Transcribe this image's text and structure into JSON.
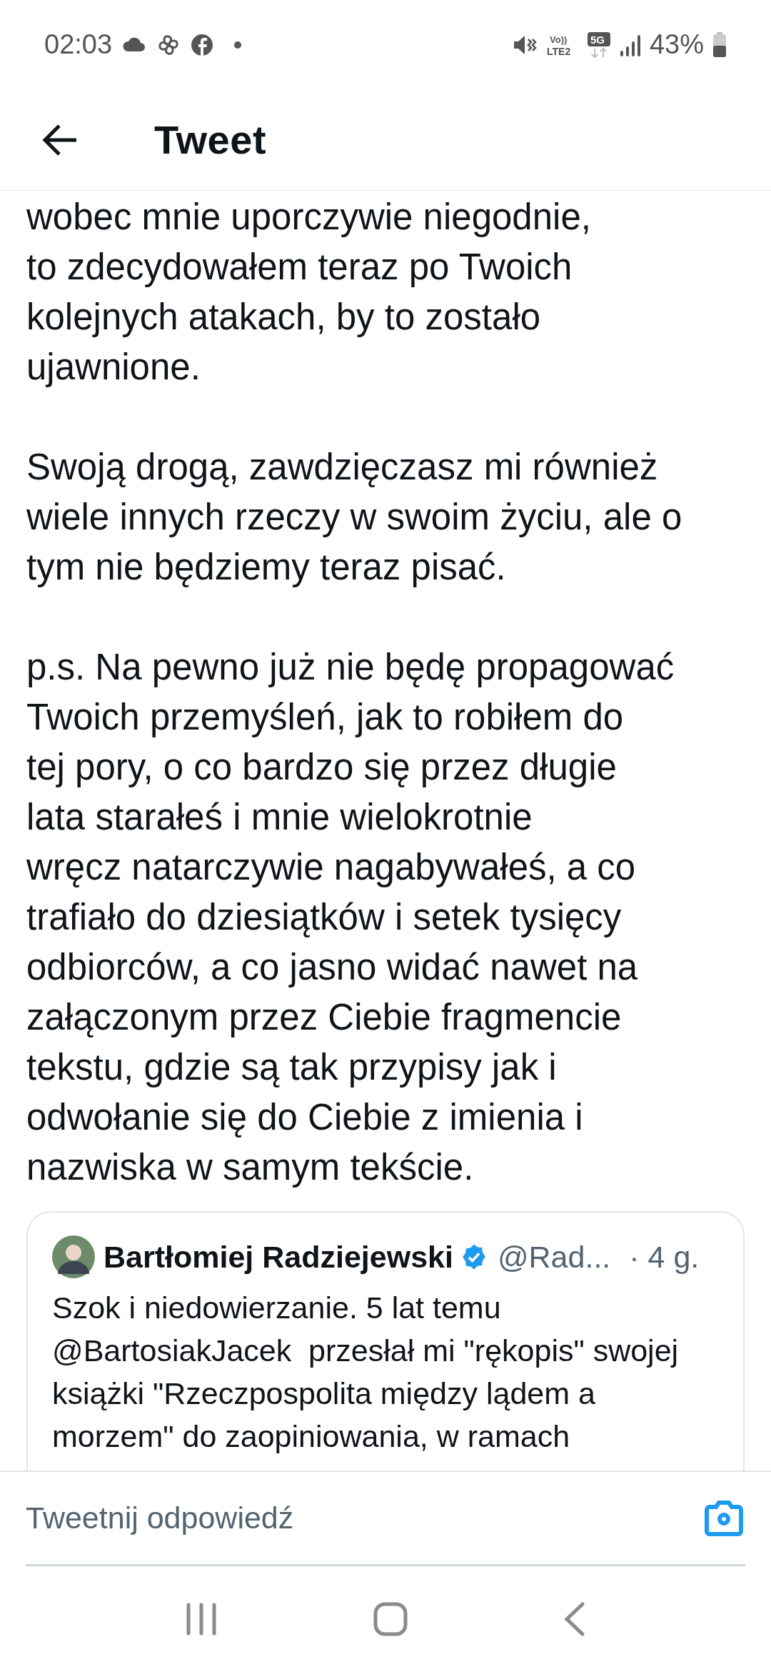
{
  "status_bar": {
    "time": "02:03",
    "volte_top": "Vo))",
    "volte_bottom": "LTE2",
    "network": "5G",
    "battery": "43%"
  },
  "header": {
    "title": "Tweet"
  },
  "tweet": {
    "paragraphs": [
      {
        "lines": [
          "wobec mnie uporczywie niegodnie,",
          "to zdecydowałem teraz po Twoich",
          "kolejnych atakach, by to zostało",
          "ujawnione."
        ]
      },
      {
        "lines": [
          "Swoją drogą, zawdzięczasz mi również",
          "wiele innych rzeczy w swoim życiu, ale o",
          "tym nie będziemy teraz pisać."
        ]
      },
      {
        "lines": [
          "p.s. Na pewno już nie będę propagować",
          "Twoich przemyśleń, jak to robiłem do",
          "tej pory, o co bardzo się przez długie",
          "lata starałeś i mnie wielokrotnie",
          "wręcz natarczywie nagabywałeś, a co",
          "trafiało do dziesiątków i setek tysięcy",
          "odbiorców, a co jasno widać nawet na",
          "załączonym przez Ciebie fragmencie",
          "tekstu, gdzie są tak przypisy jak i",
          "odwołanie się do Ciebie z imienia i",
          "nazwiska w samym tekście."
        ]
      }
    ]
  },
  "quoted_tweet": {
    "name": "Bartłomiej Radziejewski",
    "verified": true,
    "handle": "@Rad...",
    "time": "· 4 g.",
    "lines": [
      "Szok i niedowierzanie. 5 lat temu",
      "@BartosiakJacek  przesłał mi \"rękopis\" swojej",
      "książki \"Rzeczpospolita między lądem a",
      "morzem\" do zaopiniowania, w ramach"
    ]
  },
  "reply": {
    "placeholder": "Tweetnij odpowiedź"
  }
}
